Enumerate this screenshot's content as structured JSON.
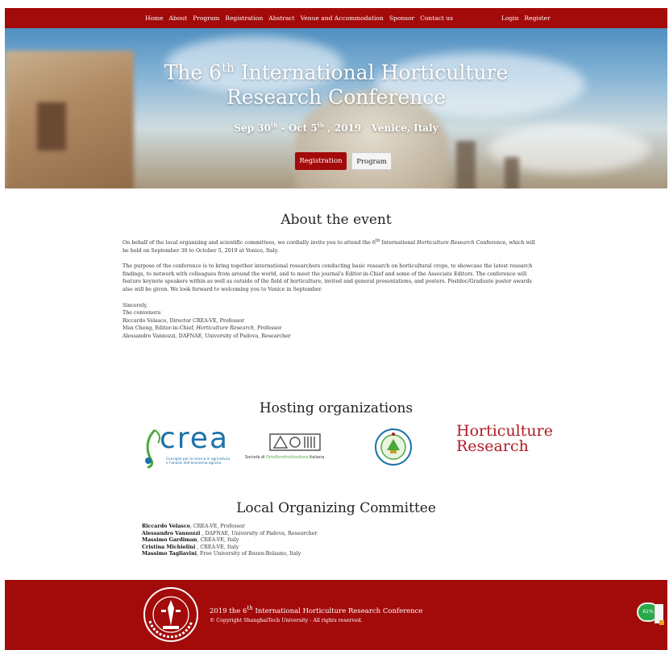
{
  "nav": {
    "links": [
      "Home",
      "About",
      "Program",
      "Registration",
      "Abstract",
      "Venue and Accommodation",
      "Sponsor",
      "Contact us"
    ],
    "login": "Login",
    "register": "Register"
  },
  "hero": {
    "title_pre": "The 6",
    "title_sup": "th",
    "title_line1_rest": " International Horticulture",
    "title_line2": "Research Conference",
    "date_a": "Sep 30",
    "date_a_sup": "th",
    "date_b": " - Oct 5",
    "date_b_sup": "th",
    "date_c": " , 2019   Venice, Italy",
    "btn_registration": "Registration",
    "btn_program": "Program"
  },
  "about": {
    "heading": "About the event",
    "p1_a": "On behalf of the local organizing and scientific committees, we cordially invite you to attend the 6",
    "p1_sup": "th",
    "p1_b": " International ",
    "p1_em": "Horticulture Research",
    "p1_c": " Conference, which will be held on September 30 to October 5, 2019 at Venice, Italy.",
    "p2": "The purpose of the conference is to bring together international researchers conducting basic research on horticultural crops, to showcase the latest research findings, to network with colleagues from around the world, and to meet the journal's Editor-in-Chief and some of the Associate Editors. The conference will feature keynote speakers within as well as outside of the field of horticulture, invited and general presentations, and posters. Postdoc/Graduate poster awards also will be given. We look forward to welcoming you to Venice in September.",
    "sincerely": "Sincerely,",
    "conveners": "The conveners:",
    "c1": "Riccardo Velasco, Director CREA-VE, Professor",
    "c2_a": "Max Cheng, Editor-in-Chief, ",
    "c2_em": "Horticulture Research",
    "c2_b": ", Professor",
    "c3": "Alessandro Vannozzi, DAFNAE, University of Padova, Researcher"
  },
  "hosting": {
    "heading": "Hosting organizations",
    "crea_word": "crea",
    "crea_sub1": "Consiglio per la ricerca in agricoltura",
    "crea_sub2": "e l'analisi dell'economia agraria",
    "soi_a": "Società di ",
    "soi_b": "Ortoflorofrutticoltura",
    "soi_c": " Italiana",
    "hr_line1": "Horticulture",
    "hr_line2": "Research"
  },
  "committee": {
    "heading": "Local Organizing Committee",
    "members": [
      {
        "name": "Riccardo Velasco",
        "detail": ", CREA-VE, Professor"
      },
      {
        "name": "Alessandro Vannozzi",
        "detail": " , DAFNAE, University of Padova, Researcher"
      },
      {
        "name": "Massimo Gardiman",
        "detail": ", CREA-VE, Italy"
      },
      {
        "name": "Cristina Michielini",
        "detail": " , CREA-VE, Italy"
      },
      {
        "name": "Massimo Tagliavini",
        "detail": ", Free University of Bozen-Bolzano, Italy"
      }
    ]
  },
  "footer": {
    "line1_a": "2019 the 6",
    "line1_sup": "th",
    "line1_b": " International Horticulture Research Conference",
    "line2": "© Copyright ShanghaiTech University - All rights reserved."
  },
  "badge": {
    "text": "61%"
  },
  "colors": {
    "brand_red": "#a30a0a",
    "crea_blue": "#1b72a8",
    "crea_green": "#4aa83a",
    "hr_red": "#b01c24"
  }
}
